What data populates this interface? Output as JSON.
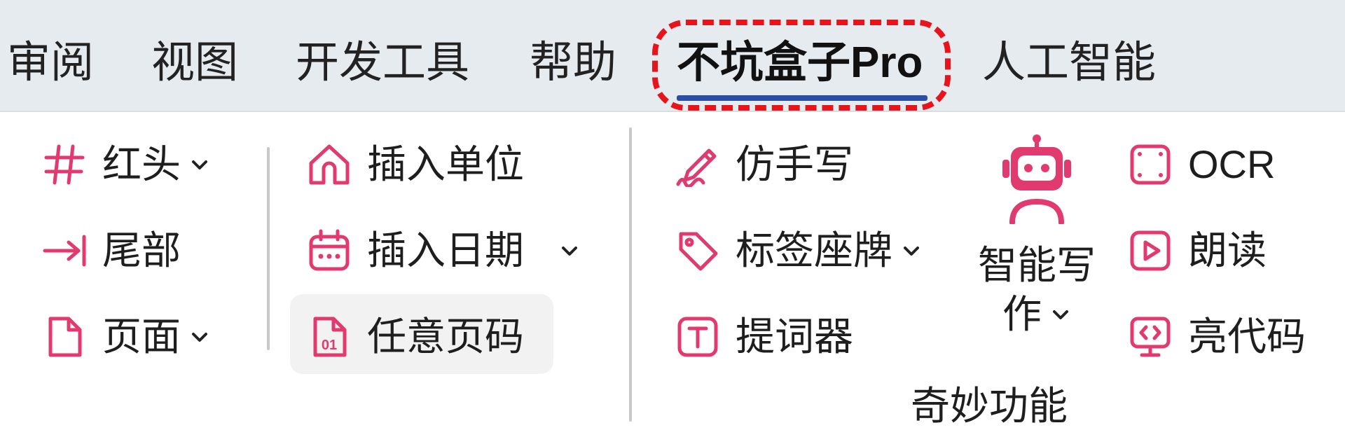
{
  "menu": {
    "tabs": [
      "审阅",
      "视图",
      "开发工具",
      "帮助",
      "不坑盒子Pro",
      "人工智能"
    ],
    "active_tab": "不坑盒子Pro"
  },
  "ribbon": {
    "col1": {
      "redhead": "红头",
      "footer": "尾部",
      "page": "页面"
    },
    "col2": {
      "insert_unit": "插入单位",
      "insert_date": "插入日期",
      "any_page_number": "任意页码"
    },
    "col3": {
      "imitate_handwriting": "仿手写",
      "label_nameplate": "标签座牌",
      "teleprompter": "提词器"
    },
    "big_button": {
      "line1": "智能写",
      "line2": "作"
    },
    "col5": {
      "ocr": "OCR",
      "read_aloud": "朗读",
      "highlight_code": "亮代码"
    },
    "group_label": "奇妙功能"
  },
  "colors": {
    "accent_pink": "#e03a6e",
    "underline_blue": "#2a4ea3",
    "highlight_red": "#e8141c"
  }
}
